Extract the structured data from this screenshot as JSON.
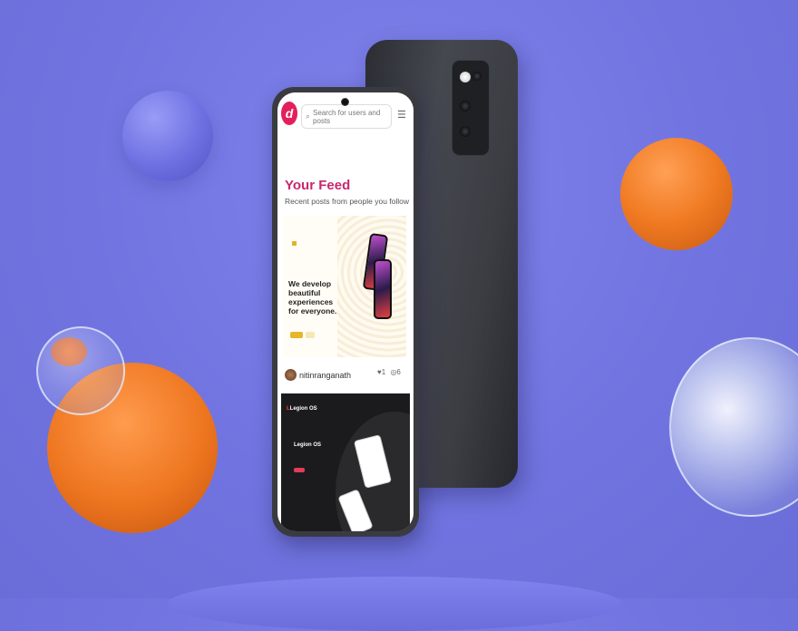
{
  "search": {
    "placeholder": "Search for users and posts"
  },
  "feed": {
    "title": "Your Feed",
    "subtitle": "Recent posts from people you follow"
  },
  "post1": {
    "tagline_line1": "We develop",
    "tagline_line2": "beautiful experiences",
    "tagline_line3": "for everyone.",
    "author": "nitinranganath",
    "likes": "1",
    "comments": "6"
  },
  "post2": {
    "brand": "Legion OS",
    "title": "Legion OS"
  },
  "icons": [
    "search-icon",
    "menu-icon",
    "heart-icon",
    "comment-icon",
    "logo-d"
  ],
  "colors": {
    "background": "#7174e0",
    "accent": "#c6286f",
    "logo": "#e3205c",
    "orange": "#f07a22"
  }
}
